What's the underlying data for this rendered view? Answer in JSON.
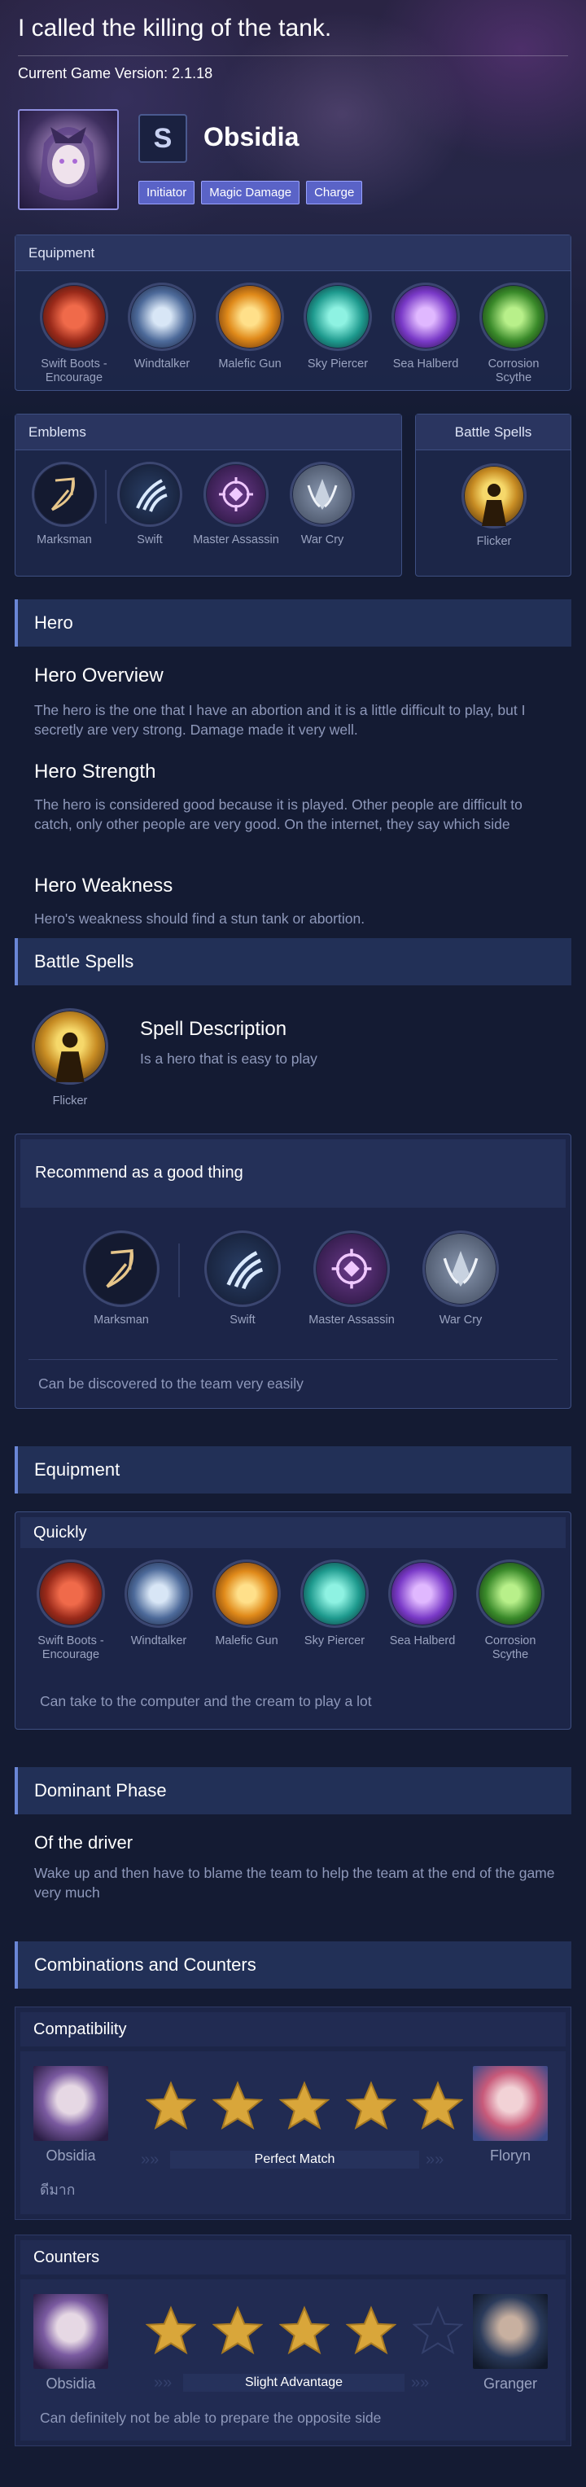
{
  "header": {
    "title": "I called the killing of the tank.",
    "version": "Current Game Version: 2.1.18",
    "hero_name": "Obsidia",
    "role_icon": "S",
    "tags": [
      "Initiator",
      "Magic Damage",
      "Charge"
    ]
  },
  "equipment_panel": {
    "title": "Equipment",
    "items": [
      "Swift Boots - Encourage",
      "Windtalker",
      "Malefic Gun",
      "Sky Piercer",
      "Sea Halberd",
      "Corrosion Scythe"
    ]
  },
  "emblems_panel": {
    "title": "Emblems",
    "main": "Marksman",
    "talents": [
      "Swift",
      "Master Assassin",
      "War Cry"
    ]
  },
  "spells_panel": {
    "title": "Battle Spells",
    "spell": "Flicker"
  },
  "hero_section": {
    "title": "Hero",
    "overview_title": "Hero Overview",
    "overview_text": "The hero is the one that I have an abortion and it is a little difficult to play, but I secretly are very strong. Damage made it very well.",
    "strength_title": "Hero Strength",
    "strength_text": "The hero is considered good because it is played. Other people are difficult to catch, only other people are very good. On the internet, they say which side",
    "weakness_title": "Hero Weakness",
    "weakness_text": "Hero's weakness should find a stun tank or abortion."
  },
  "battle_spells_section": {
    "title": "Battle Spells",
    "spell": "Flicker",
    "desc_title": "Spell Description",
    "desc_text": "Is a hero that is easy to play"
  },
  "recommend": {
    "title": "Recommend as a good thing",
    "main": "Marksman",
    "talents": [
      "Swift",
      "Master Assassin",
      "War Cry"
    ],
    "note": "Can be discovered to the team very easily"
  },
  "equipment_section": {
    "title": "Equipment",
    "build_title": "Quickly",
    "items": [
      "Swift Boots - Encourage",
      "Windtalker",
      "Malefic Gun",
      "Sky Piercer",
      "Sea Halberd",
      "Corrosion Scythe"
    ],
    "note": "Can take to the computer and the cream to play a lot"
  },
  "dominant": {
    "title": "Dominant Phase",
    "subtitle": "Of the driver",
    "text": "Wake up and then have to blame the team to help the team at the end of the game very much"
  },
  "combos": {
    "title": "Combinations and Counters",
    "compat": {
      "title": "Compatibility",
      "left": "Obsidia",
      "right": "Floryn",
      "stars": 5,
      "label": "Perfect Match",
      "note": "ดีมาก"
    },
    "counters": {
      "title": "Counters",
      "left": "Obsidia",
      "right": "Granger",
      "stars": 4,
      "label": "Slight Advantage",
      "note": "Can definitely not be able to prepare the opposite side"
    }
  },
  "colors": {
    "accent": "#6a86d6",
    "tag": "#5a63c7",
    "star": "#d9a63a"
  }
}
